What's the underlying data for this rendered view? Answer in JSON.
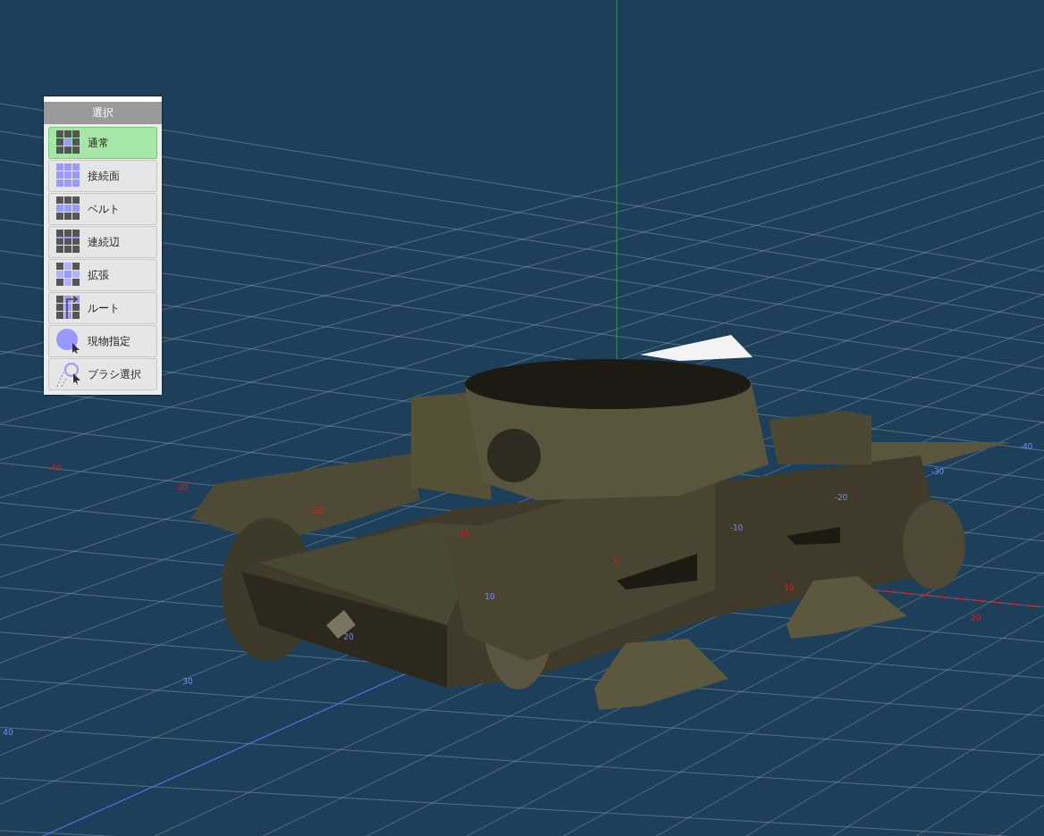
{
  "selection_panel": {
    "title": "選択",
    "items": [
      {
        "label": "通常",
        "kind": "normal",
        "selected": true
      },
      {
        "label": "接続面",
        "kind": "connected",
        "selected": false
      },
      {
        "label": "ベルト",
        "kind": "belt",
        "selected": false
      },
      {
        "label": "連続辺",
        "kind": "edge-loop",
        "selected": false
      },
      {
        "label": "拡張",
        "kind": "expand",
        "selected": false
      },
      {
        "label": "ルート",
        "kind": "route",
        "selected": false
      },
      {
        "label": "現物指定",
        "kind": "object",
        "selected": false
      },
      {
        "label": "ブラシ選択",
        "kind": "brush",
        "selected": false
      }
    ]
  },
  "viewport": {
    "x_axis_labels": [
      "-40",
      "-30",
      "-20",
      "-10",
      "0",
      "10",
      "20"
    ],
    "z_axis_labels": [
      "40",
      "30",
      "20",
      "10",
      "-10",
      "-20",
      "-30",
      "-40"
    ]
  }
}
